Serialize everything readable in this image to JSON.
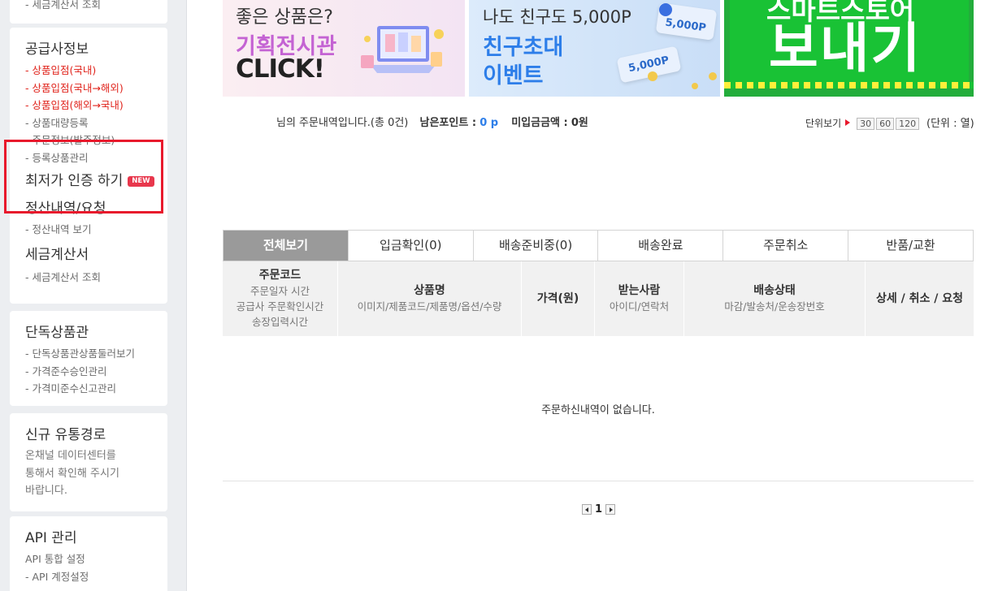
{
  "sidebar": {
    "top_card": {
      "link": "- 세금계산서 조회"
    },
    "supplier_card": {
      "title": "공급사정보",
      "links": [
        {
          "label": "- 상품입점(국내)",
          "red": true
        },
        {
          "label": "- 상품입점(국내→해외)",
          "red": true
        },
        {
          "label": "- 상품입점(해외→국내)",
          "red": true
        },
        {
          "label": "- 상품대량등록",
          "red": false
        },
        {
          "label": "- 주문정보(발주정보)",
          "red": false
        },
        {
          "label": "- 등록상품관리",
          "red": false
        }
      ],
      "lowest_price_title": "최저가 인증 하기",
      "new_badge": "NEW",
      "settlement_title": "정산내역/요청",
      "settlement_link": "- 정산내역 보기",
      "tax_title": "세금계산서",
      "tax_link": "- 세금계산서 조회"
    },
    "exclusive_card": {
      "title": "단독상품관",
      "links": [
        "- 단독상품관상품둘러보기",
        "- 가격준수승인관리",
        "- 가격미준수신고관리"
      ]
    },
    "channel_card": {
      "title": "신규 유통경로",
      "desc": [
        "온채널 데이터센터를",
        "통해서 확인해 주시기",
        "바랍니다."
      ]
    },
    "api_card": {
      "title": "API 관리",
      "links": [
        "API 통합 설정",
        "- API 계정설정"
      ]
    }
  },
  "banners": {
    "b1": {
      "line1": "좋은 상품은?",
      "line2": "기획전시관",
      "line3": "CLICK!"
    },
    "b2": {
      "line1": "나도 친구도 5,000P",
      "line2": "친구초대",
      "line3": "이벤트",
      "coupon1": "5,000P",
      "coupon2": "5,000P"
    },
    "b3": {
      "line1": "스마트스토어",
      "line2": "보내기"
    }
  },
  "info": {
    "order_text": "님의 주문내역입니다.(총 0건)",
    "points_label": "남은포인트 :",
    "points_value": "0 p",
    "unpaid_label": "미입금금액 :",
    "unpaid_value": "0원",
    "unit_label": "단위보기",
    "unit_options": [
      "30",
      "60",
      "120"
    ],
    "unit_suffix": "(단위 : 열)"
  },
  "tabs": [
    {
      "label": "전체보기",
      "active": true
    },
    {
      "label": "입금확인(0)",
      "active": false
    },
    {
      "label": "배송준비중(0)",
      "active": false
    },
    {
      "label": "배송완료",
      "active": false
    },
    {
      "label": "주문취소",
      "active": false
    },
    {
      "label": "반품/교환",
      "active": false
    }
  ],
  "table": {
    "headers": [
      {
        "main": "주문코드",
        "sub": [
          "주문일자 시간",
          "공급사 주문확인시간",
          "송장입력시간"
        ]
      },
      {
        "main": "상품명",
        "sub": [
          "이미지/제품코드/제품명/옵션/수량"
        ]
      },
      {
        "main": "가격(원)",
        "sub": []
      },
      {
        "main": "받는사람",
        "sub": [
          "아이디/연락처"
        ]
      },
      {
        "main": "배송상태",
        "sub": [
          "마감/발송처/운송장번호"
        ]
      },
      {
        "main": "상세 / 취소 / 요청",
        "sub": []
      }
    ],
    "empty_message": "주문하신내역이 없습니다."
  },
  "pager": {
    "current": "1"
  },
  "colors": {
    "accent_red": "#e8192c",
    "active_tab": "#9a9a9a",
    "point_blue": "#2d7ee9"
  }
}
